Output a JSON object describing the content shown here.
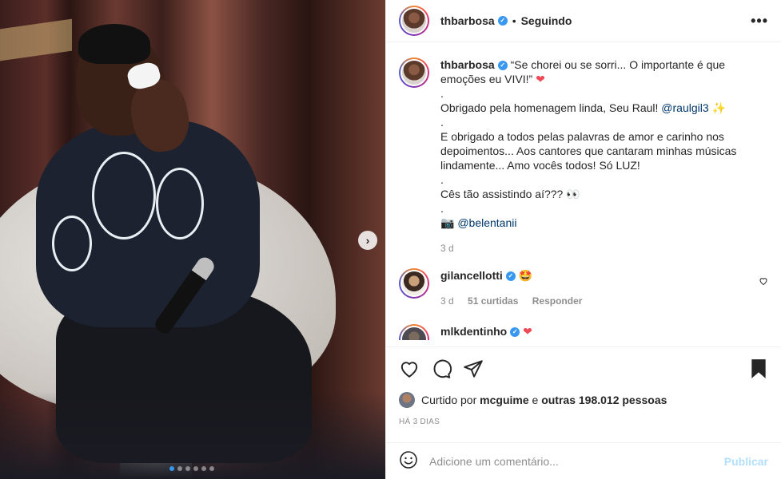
{
  "post": {
    "media_dots": 6,
    "active_dot": 0
  },
  "header": {
    "username": "thbarbosa",
    "separator": "•",
    "follow_status": "Seguindo",
    "more_label": "•••"
  },
  "caption": {
    "username": "thbarbosa",
    "line1": "“Se chorei ou se sorri... O importante é que emoções eu VIVI!”",
    "heart": "❤",
    "dot1": ".",
    "thanks_text": "Obrigado pela homenagem linda, Seu Raul! ",
    "thanks_mention": "@raulgil3",
    "thanks_emoji": "✨",
    "dot2": ".",
    "paragraph2": "E obrigado a todos pelas palavras de amor e carinho nos depoimentos... Aos cantores que cantaram minhas músicas lindamente... Amo vocês todos! Só LUZ!",
    "dot3": ".",
    "question": "Cês tão assistindo aí??? 👀",
    "dot4": ".",
    "camera": "📷",
    "credit": "@belentanii",
    "time": "3 d"
  },
  "comments": [
    {
      "username": "gilancellotti",
      "text": "🤩",
      "time": "3 d",
      "likes": "51 curtidas",
      "reply": "Responder"
    },
    {
      "username": "mlkdentinho",
      "text": "❤"
    }
  ],
  "likes": {
    "prefix": "Curtido por ",
    "user": "mcguime",
    "middle": " e ",
    "others": "outras 198.012 pessoas"
  },
  "timestamp": "HÁ 3 DIAS",
  "comment_box": {
    "emoji": "☺",
    "placeholder": "Adicione um comentário...",
    "publish": "Publicar"
  },
  "colors": {
    "link": "#00376b",
    "verified": "#3897f0",
    "heart": "#ed4956",
    "muted": "#8e8e8e",
    "publish_disabled": "#b2dffc"
  }
}
